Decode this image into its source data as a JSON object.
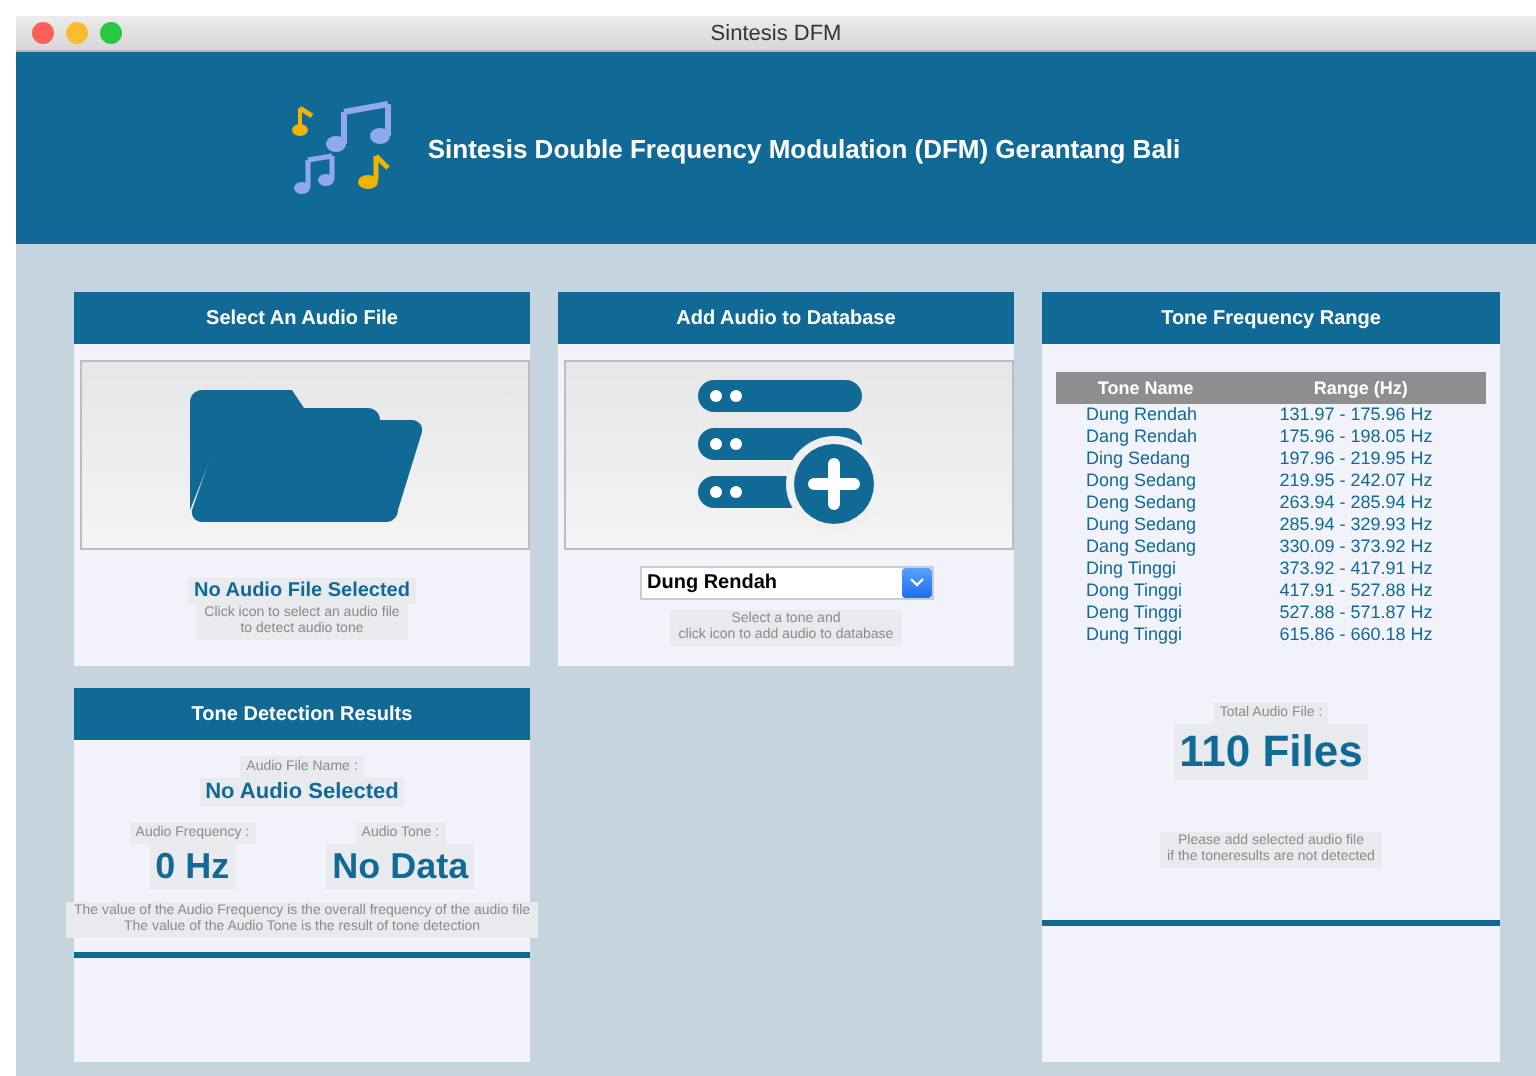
{
  "window": {
    "title": "Sintesis DFM"
  },
  "header": {
    "title": "Sintesis Double Frequency Modulation (DFM) Gerantang Bali"
  },
  "select_panel": {
    "title": "Select An Audio File",
    "status": "No Audio File Selected",
    "hint": "Click icon to select an audio file\nto detect audio tone"
  },
  "database_panel": {
    "title": "Add Audio to Database",
    "tone_value": "Dung Rendah",
    "hint": "Select a tone and\nclick icon to add audio to database"
  },
  "results_panel": {
    "title": "Tone Detection Results",
    "file_label": "Audio File Name :",
    "file_value": "No Audio Selected",
    "frequency_label": "Audio Frequency :",
    "frequency_value": "0 Hz",
    "tone_label": "Audio Tone :",
    "tone_value": "No Data",
    "note": "The value of the Audio Frequency is the overall frequency of the audio file\nThe value of the Audio Tone is the result of tone detection"
  },
  "range_panel": {
    "title": "Tone Frequency Range",
    "columns": [
      "Tone Name",
      "Range (Hz)"
    ],
    "rows": [
      [
        "Dung Rendah",
        "131.97 - 175.96 Hz"
      ],
      [
        "Dang Rendah",
        "175.96 - 198.05 Hz"
      ],
      [
        "Ding Sedang",
        "197.96 - 219.95 Hz"
      ],
      [
        "Dong Sedang",
        "219.95 - 242.07 Hz"
      ],
      [
        "Deng Sedang",
        "263.94 - 285.94 Hz"
      ],
      [
        "Dung Sedang",
        "285.94 - 329.93 Hz"
      ],
      [
        "Dang Sedang",
        "330.09 - 373.92 Hz"
      ],
      [
        "Ding Tinggi",
        "373.92 - 417.91 Hz"
      ],
      [
        "Dong Tinggi",
        "417.91 - 527.88 Hz"
      ],
      [
        "Deng Tinggi",
        "527.88 - 571.87 Hz"
      ],
      [
        "Dung Tinggi",
        "615.86 - 660.18 Hz"
      ]
    ],
    "total_label": "Total Audio File :",
    "total_value": "110 Files",
    "hint": "Please add selected audio file\nif the toneresults are not detected"
  }
}
